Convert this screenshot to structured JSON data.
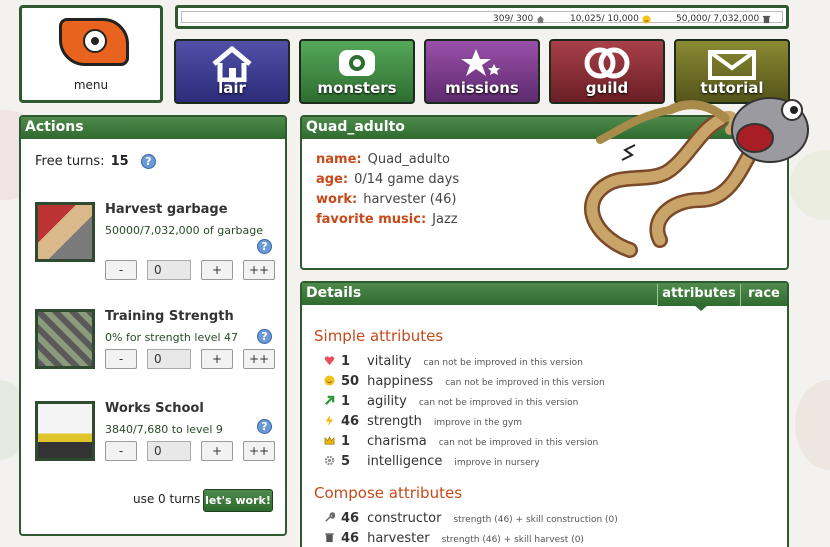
{
  "menu": {
    "label": "menu"
  },
  "resources": [
    {
      "text": "309/ 300",
      "icon": "house-icon"
    },
    {
      "text": "10,025/ 10,000",
      "icon": "happy-face-icon"
    },
    {
      "text": "50,000/ 7,032,000",
      "icon": "trash-can-icon"
    }
  ],
  "nav": [
    {
      "label": "lair",
      "icon": "house-icon",
      "color": "#3a3a8e"
    },
    {
      "label": "monsters",
      "icon": "monster-eye-icon",
      "color": "#3c8a3e"
    },
    {
      "label": "missions",
      "icon": "stars-icon",
      "color": "#7a3a8a"
    },
    {
      "label": "guild",
      "icon": "rings-icon",
      "color": "#8a2a2e"
    },
    {
      "label": "tutorial",
      "icon": "envelope-icon",
      "color": "#6a6a22"
    }
  ],
  "actions_panel": {
    "title": "Actions",
    "free_turns_label": "Free turns:",
    "free_turns_value": "15",
    "help": "?",
    "items": [
      {
        "title": "Harvest garbage",
        "desc": "50000/7,032,000 of garbage",
        "value": "0"
      },
      {
        "title": "Training Strength",
        "desc": "0% for strength level 47",
        "value": "0"
      },
      {
        "title": "Works School",
        "desc": "3840/7,680 to level 9",
        "value": "0"
      }
    ],
    "btn_minus": "-",
    "btn_plus": "+",
    "btn_plusplus": "++",
    "use_turns": "use 0 turns",
    "work_button": "let's work!"
  },
  "profile": {
    "title": "Quad_adulto",
    "rows": [
      {
        "label": "name:",
        "value": "Quad_adulto"
      },
      {
        "label": "age:",
        "value": "0/14 game days"
      },
      {
        "label": "work:",
        "value": "harvester (46)"
      },
      {
        "label": "favorite music:",
        "value": "Jazz"
      }
    ]
  },
  "details": {
    "title": "Details",
    "tabs": [
      "attributes",
      "race"
    ],
    "simple_title": "Simple attributes",
    "simple": [
      {
        "icon": "heart-icon",
        "value": "1",
        "name": "vitality",
        "note": "can not be improved in this version"
      },
      {
        "icon": "smiley-icon",
        "value": "50",
        "name": "happiness",
        "note": "can not be improved in this version"
      },
      {
        "icon": "arrow-up-right-icon",
        "value": "1",
        "name": "agility",
        "note": "can not be improved in this version"
      },
      {
        "icon": "lightning-icon",
        "value": "46",
        "name": "strength",
        "note": "improve in the gym"
      },
      {
        "icon": "crown-icon",
        "value": "1",
        "name": "charisma",
        "note": "can not be improved in this version"
      },
      {
        "icon": "gear-icon",
        "value": "5",
        "name": "intelligence",
        "note": "improve in nursery"
      }
    ],
    "compose_title": "Compose attributes",
    "compose": [
      {
        "icon": "wrench-icon",
        "value": "46",
        "name": "constructor",
        "note": "strength (46) + skill construction (0)"
      },
      {
        "icon": "trash-can-icon",
        "value": "46",
        "name": "harvester",
        "note": "strength (46) + skill harvest (0)"
      }
    ]
  }
}
